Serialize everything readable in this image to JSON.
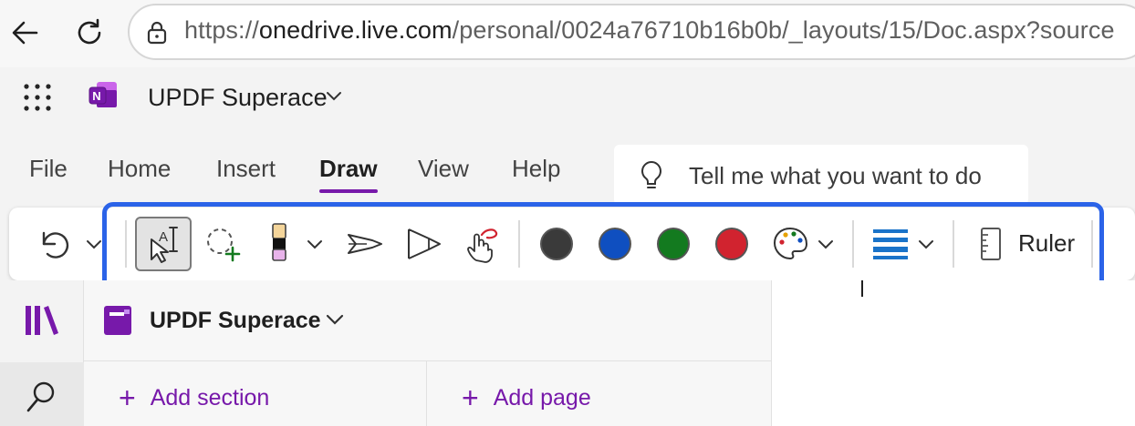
{
  "browser": {
    "url_prefix": "https://",
    "url_host": "onedrive.live.com",
    "url_path": "/personal/0024a76710b16b0b/_layouts/15/Doc.aspx?source"
  },
  "app": {
    "notebook_name": "UPDF Superace"
  },
  "tabs": [
    {
      "label": "File"
    },
    {
      "label": "Home"
    },
    {
      "label": "Insert"
    },
    {
      "label": "Draw",
      "active": true
    },
    {
      "label": "View"
    },
    {
      "label": "Help"
    }
  ],
  "tell_me": {
    "placeholder": "Tell me what you want to do"
  },
  "toolbar": {
    "icons": [
      "undo-icon",
      "lasso-select-icon",
      "lasso-add-icon",
      "highlighter-icon",
      "pen-icon",
      "pencil-cone-icon",
      "touch-draw-icon",
      "color-palette-icon",
      "line-thickness-icon",
      "ruler-icon"
    ],
    "colors": [
      "#3a3a3a",
      "#0f4fc0",
      "#137a1f",
      "#d1232f"
    ],
    "ruler_label": "Ruler"
  },
  "notebook_pane": {
    "title": "UPDF Superace",
    "add_section": "Add section",
    "add_page": "Add page"
  },
  "colors": {
    "accent": "#7719aa",
    "highlight": "#2b63e8"
  }
}
